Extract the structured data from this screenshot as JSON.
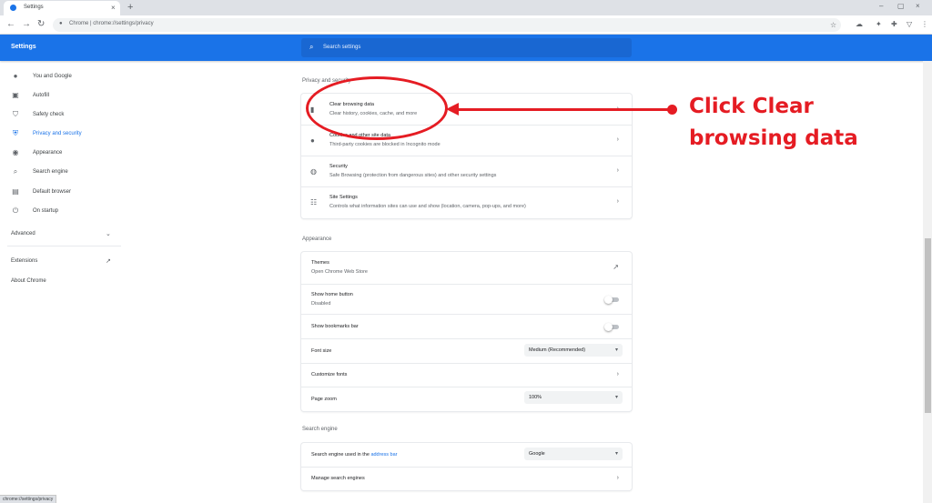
{
  "browser": {
    "tab_title": "Settings",
    "tab_close": "×",
    "new_tab": "+",
    "url": "Chrome  |  chrome://settings/privacy",
    "window_controls": [
      "–",
      "▢",
      "×"
    ]
  },
  "header": {
    "title": "Settings",
    "search_placeholder": "Search settings"
  },
  "sidebar": {
    "items": [
      {
        "label": "You and Google",
        "icon": "person-icon"
      },
      {
        "label": "Autofill",
        "icon": "clipboard-icon"
      },
      {
        "label": "Safety check",
        "icon": "shield-check-icon"
      },
      {
        "label": "Privacy and security",
        "icon": "shield-icon"
      },
      {
        "label": "Appearance",
        "icon": "palette-icon"
      },
      {
        "label": "Search engine",
        "icon": "search-icon"
      },
      {
        "label": "Default browser",
        "icon": "browser-icon"
      },
      {
        "label": "On startup",
        "icon": "power-icon"
      }
    ],
    "advanced": "Advanced",
    "extensions": "Extensions",
    "about": "About Chrome"
  },
  "privacy": {
    "section_title": "Privacy and security",
    "rows": [
      {
        "title": "Clear browsing data",
        "subtitle": "Clear history, cookies, cache, and more"
      },
      {
        "title": "Cookies and other site data",
        "subtitle": "Third-party cookies are blocked in Incognito mode"
      },
      {
        "title": "Security",
        "subtitle": "Safe Browsing (protection from dangerous sites) and other security settings"
      },
      {
        "title": "Site Settings",
        "subtitle": "Controls what information sites can use and show (location, camera, pop-ups, and more)"
      }
    ]
  },
  "appearance": {
    "section_title": "Appearance",
    "themes_title": "Themes",
    "themes_subtitle": "Open Chrome Web Store",
    "home_button_title": "Show home button",
    "home_button_subtitle": "Disabled",
    "bookmarks_bar_title": "Show bookmarks bar",
    "font_size_label": "Font size",
    "font_size_value": "Medium (Recommended)",
    "customize_fonts": "Customize fonts",
    "page_zoom_label": "Page zoom",
    "page_zoom_value": "100%"
  },
  "search_engine": {
    "section_title": "Search engine",
    "used_in_prefix": "Search engine used in the ",
    "used_in_link": "address bar",
    "engine_value": "Google",
    "manage": "Manage search engines"
  },
  "status_url": "chrome://settings/privacy",
  "annotation": {
    "line1": "Click Clear",
    "line2": "browsing data",
    "color": "#e51c23"
  },
  "colors": {
    "accent": "#1a73e8"
  }
}
